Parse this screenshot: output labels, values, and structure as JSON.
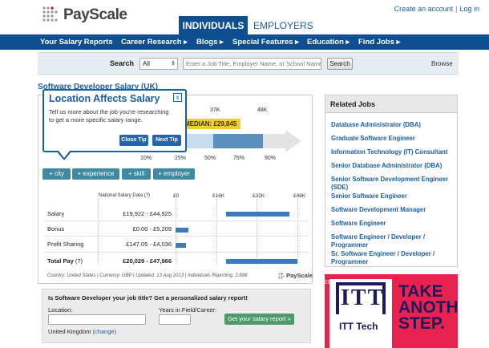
{
  "header": {
    "logo_text": "PayScale",
    "tabs": [
      {
        "label": "INDIVIDUALS"
      },
      {
        "label": "EMPLOYERS"
      }
    ],
    "links": {
      "create": "Create an account",
      "sep": "|",
      "login": "Log in"
    }
  },
  "nav": {
    "items": [
      {
        "label": "Your Salary Reports"
      },
      {
        "label": "Career Research ▸"
      },
      {
        "label": "Blogs ▸"
      },
      {
        "label": "Special Features ▸"
      },
      {
        "label": "Education ▸"
      },
      {
        "label": "Find Jobs ▸"
      }
    ]
  },
  "search": {
    "label": "Search",
    "category": "All",
    "placeholder": "Enter a Job Title, Employer Name, or School Name",
    "button": "Search",
    "browse": "Browse"
  },
  "page": {
    "title": "Software Developer Salary",
    "country": "(UK)"
  },
  "tooltip": {
    "title": "Location Affects Salary",
    "body": "Tell us more about the job you're researching to get a more specific salary range.",
    "close_label": "Close Tip",
    "next_label": "Next Tip",
    "close_icon": "close-icon"
  },
  "range": {
    "top_labels": [
      "37K",
      "48K"
    ],
    "median": "MEDIAN: £29,845",
    "percentiles": [
      "10%",
      "25%",
      "50%",
      "75%",
      "90%"
    ],
    "colors": {
      "median_bg": "#f3cd28",
      "bar_dark": "#5b8fc2",
      "bar_light": "#c7dcef",
      "arrow": "#e3e3e3"
    }
  },
  "filters": [
    {
      "label": "+ city"
    },
    {
      "label": "+ experience"
    },
    {
      "label": "+ skill"
    },
    {
      "label": "+ employer"
    }
  ],
  "salary_table": {
    "header": "National Salary Data (?)",
    "axis": [
      "£0",
      "£16K",
      "£32K",
      "£48K"
    ],
    "rows": [
      {
        "label": "Salary",
        "value": "£19,922 - £44,925",
        "min": 19922,
        "max": 44925
      },
      {
        "label": "Bonus",
        "value": "£0.00 - £5,209",
        "min": 0,
        "max": 5209
      },
      {
        "label": "Profit Sharing",
        "value": "£147.05 - £4,036",
        "min": 147.05,
        "max": 4036
      },
      {
        "label": "Total Pay",
        "label_suffix": "(?)",
        "value": "£20,029 - £47,966",
        "min": 20029,
        "max": 47966
      }
    ],
    "axis_max": 48000,
    "meta": "Country: United States | Currency: GBP | Updated: 13 Aug 2013 | Individuals Reporting: 2,698",
    "brand": "PayScale"
  },
  "cta": {
    "question": "Is Software Developer your job title? Get a personalized salary report!",
    "location_label": "Location:",
    "years_label": "Years in Field/Career:",
    "button": "Get your salary report »",
    "country": "United Kingdom",
    "change": "(change)"
  },
  "related": {
    "title": "Related Jobs",
    "jobs": [
      "Database Administrator (DBA)",
      "Graduate Software Engineer",
      "Information Technology (IT) Consultant",
      "Senior Database Administrator (DBA)",
      "Senior Software Development Engineer (SDE)",
      "Senior Software Engineer",
      "Software Development Manager",
      "Software Engineer",
      "Software Engineer / Developer / Programmer",
      "Sr. Software Engineer / Developer / Programmer"
    ]
  },
  "ad": {
    "logo": "ITT",
    "brand": "ITT Tech",
    "slogan": [
      "TAKE",
      "ANOTHER",
      "STEP."
    ],
    "side": "EEEEEEEE",
    "colors": {
      "bg": "#e8214f",
      "ink": "#1d1a5e"
    }
  }
}
